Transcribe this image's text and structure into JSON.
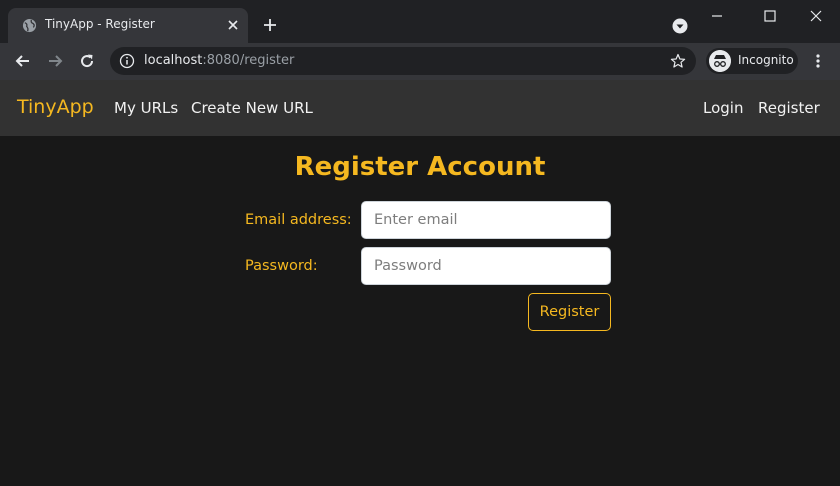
{
  "browser": {
    "tab_title": "TinyApp - Register",
    "url_host": "localhost",
    "url_rest": ":8080/register",
    "profile_label": "Incognito"
  },
  "navbar": {
    "brand": "TinyApp",
    "links_left": [
      "My URLs",
      "Create New URL"
    ],
    "links_right": [
      "Login",
      "Register"
    ]
  },
  "form": {
    "title": "Register Account",
    "email_label": "Email address:",
    "email_placeholder": "Enter email",
    "email_value": "",
    "password_label": "Password:",
    "password_placeholder": "Password",
    "password_value": "",
    "submit_label": "Register"
  },
  "colors": {
    "accent": "#f5b820",
    "page_background": "#181818",
    "navbar_background": "#323232"
  }
}
